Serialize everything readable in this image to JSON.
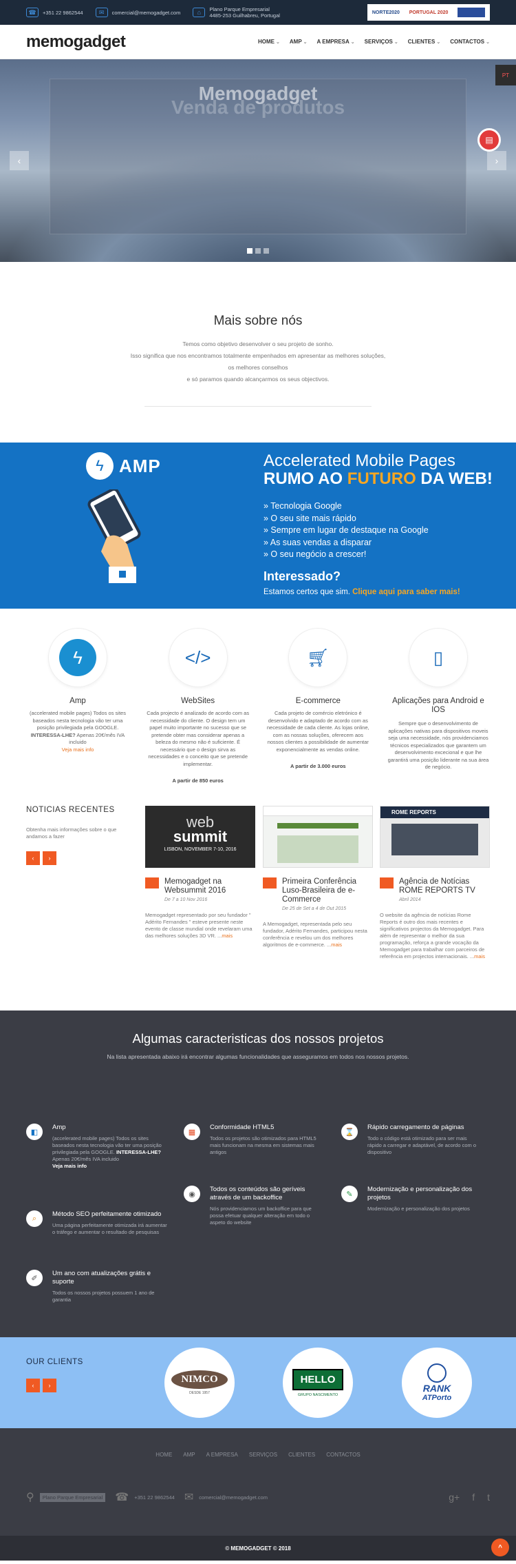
{
  "topbar": {
    "phone": "+351 22 9862544",
    "email": "comercial@memogadget.com",
    "address_1": "Plano Parque Empresarial",
    "address_2": "4485-253 Guilhabreu, Portugal",
    "banner_1": "NORTE2020",
    "banner_2": "PORTUGAL 2020"
  },
  "header": {
    "logo": "memogadget",
    "nav": [
      "HOME",
      "AMP",
      "A EMPRESA",
      "SERVIÇOS",
      "CLIENTES",
      "CONTACTOS"
    ]
  },
  "hero": {
    "title": "Memogadget",
    "subtitle": "Venda de produtos",
    "lang": "PT",
    "slide_count": 3,
    "active_slide": 1
  },
  "about": {
    "title": "Mais sobre nós",
    "line1": "Temos como objetivo desenvolver o seu projeto de sonho.",
    "line2": "Isso significa que nos encontramos totalmente empenhados em apresentar as melhores soluções,",
    "line3": "os melhores conselhos",
    "line4": "e só paramos quando alcançarmos os seus objectivos."
  },
  "amp": {
    "logo": "AMP",
    "title": "Accelerated Mobile Pages",
    "tag_a": "RUMO AO ",
    "tag_b": "FUTURO",
    "tag_c": " DA WEB!",
    "bullets": [
      "» Tecnologia Google",
      "» O seu site mais rápido",
      "» Sempre em lugar de destaque na Google",
      "» As suas vendas a disparar",
      "» O seu negócio a crescer!"
    ],
    "ask": "Interessado?",
    "cta_a": "Estamos certos que sim. ",
    "cta_b": "Clique aqui para saber mais!"
  },
  "services": [
    {
      "title": "Amp",
      "icon": "bolt-icon",
      "text": "(accelerated mobile pages) Todos os sites baseados nesta tecnologia vão ter uma posição privilegiada pela GOOGLE.",
      "strong": " INTERESSA-LHE?",
      "text2": " Apenas 20€/mês IVA incluido",
      "more": "Veja mais info",
      "price": ""
    },
    {
      "title": "WebSites",
      "icon": "code-icon",
      "text": "Cada projecto é analizado de acordo com as necessidade do cliente. O design tem um papel muito importante no sucesso que se pretende obter mas considerar apenas a beleza do mesmo não é suficiente. É necessário que o design sirva as necessidades e o conceito que se pretende implementar.",
      "strong": "",
      "text2": "",
      "more": "",
      "price": "A partir de 850 euros"
    },
    {
      "title": "E-commerce",
      "icon": "cart-icon",
      "text": "Cada projeto de comércio eletrónico é desenvolvido e adaptado de acordo com as necessidade de cada cliente. As lojas online, com as nossas soluções, oferecem aos nossos clientes a possibilidade de aumentar exponencialmente as vendas online.",
      "strong": "",
      "text2": "",
      "more": "",
      "price": "A partir de 3.000 euros"
    },
    {
      "title": "Aplicações para Android e IOS",
      "icon": "mobile-icon",
      "text": "Sempre que o desenvolvimento de aplicações nativas para dispositivos moveis seja uma necessidade, nós providenciamos técnicos especializados que garantem um desenvolvimento excecional e que lhe garantirá uma posição liderante na sua área de negócio.",
      "strong": "",
      "text2": "",
      "more": "",
      "price": ""
    }
  ],
  "news": {
    "title": "NOTICIAS RECENTES",
    "intro": "Obtenha mais informações sobre o que andamos a fazer",
    "prev": "‹",
    "next": "›",
    "items": [
      {
        "title": "Memogadget na Websummit 2016",
        "date": "De 7 a 10 Nov 2016",
        "text": "Memogadget representado por seu fundador \" Adérito Fernandes \" esteve presente neste evento de classe mundial onde revelaram uma das melhores soluções 3D VR. ...",
        "more": "mais",
        "img_text_1": "web",
        "img_text_2": "summit",
        "img_text_3": "LISBON, NOVEMBER 7-10, 2016"
      },
      {
        "title": "Primeira Conferência Luso-Brasileira de e-Commerce",
        "date": "De 25 de Set a 4 de Out 2015",
        "text": "A Memogadget, representada pelo seu fundador, Adérito Fernandes, participou nesta conferência e revelou um dos melhores algoritmos de e-commerce. ...",
        "more": "mais",
        "img_text_1": "",
        "img_text_2": "",
        "img_text_3": ""
      },
      {
        "title": "Agência de Notícias ROME REPORTS TV",
        "date": "Abril 2014",
        "text": "O website da agência de notícias Rome Reports é outro dos mais recentes e significativos projectos da Memogadget. Para além de representar o melhor da sua programação, reforça a grande vocação da Memogadget para trabalhar com parceiros de referência em projectos internacionais. ...",
        "more": "mais",
        "img_text_1": "ROME REPORTS",
        "img_text_2": "",
        "img_text_3": ""
      }
    ]
  },
  "features": {
    "title": "Algumas caracteristicas dos nossos projetos",
    "subtitle": "Na lista apresentada abaixo irá encontrar algumas funcionalidades que asseguramos em todos nos nossos projetos.",
    "items": [
      {
        "title": "Amp",
        "icon": "amp-icon",
        "text": "(accelerated mobile pages) Todos os sites baseados nesta tecnologia vão ter uma posição privilegiada pela GOOGLE. ",
        "strong": "INTERESSA-LHE?",
        "text2": " Apenas 20€/mês IVA incluido ",
        "link": "Veja mais info"
      },
      {
        "title": "Conformidade HTML5",
        "icon": "html5-icon",
        "text": "Todos os projetos são otimizados para HTML5 mais funcionam na mesma em sistemas mais antigos",
        "strong": "",
        "text2": "",
        "link": ""
      },
      {
        "title": "Rápido carregamento de páginas",
        "icon": "hourglass-icon",
        "text": "Todo o código está otimizado para ser mais rápido a carregar e adaptável, de acordo com o dispositivo",
        "strong": "",
        "text2": "",
        "link": ""
      },
      {
        "title": "Todos os conteúdos são geríveis através de um backoffice",
        "icon": "camera-icon",
        "text": "Nós providenciamos um backoffice para que possa efetuar qualquer alteração em todo o aspeto do website",
        "strong": "",
        "text2": "",
        "link": ""
      },
      {
        "title": "Modernização e personalização dos projetos",
        "icon": "tools-icon",
        "text": "Modernização e personalização dos projetos",
        "strong": "",
        "text2": "",
        "link": ""
      },
      {
        "title": "Método SEO perfeitamente otimizado",
        "icon": "search-icon",
        "text": "Uma página perfeitamente otimizada irá aumentar o tráfego e aumentar o resultado de pesquisas",
        "strong": "",
        "text2": "",
        "link": ""
      },
      {
        "title": "Um ano com atualizações grátis e suporte",
        "icon": "edit-icon",
        "text": "Todos os nossos projetos possuem 1 ano de garantia",
        "strong": "",
        "text2": "",
        "link": ""
      }
    ]
  },
  "clients": {
    "title": "OUR CLIENTS",
    "prev": "‹",
    "next": "›",
    "logos": [
      {
        "name": "NIMCO",
        "sub": "DESDE 1957"
      },
      {
        "name": "HELLO",
        "sub": "GRUPO NASCIMENTO"
      },
      {
        "name": "RANK",
        "sub": "ATPorto"
      }
    ]
  },
  "footer": {
    "nav": [
      "HOME",
      "AMP",
      "A EMPRESA",
      "SERVIÇOS",
      "CLIENTES",
      "CONTACTOS"
    ],
    "address": "Plano Parque Empresarial",
    "phone": "+351 22 9862544",
    "email": "comercial@memogadget.com",
    "copyright": "© MEMOGADGET © 2018",
    "top": "^"
  }
}
